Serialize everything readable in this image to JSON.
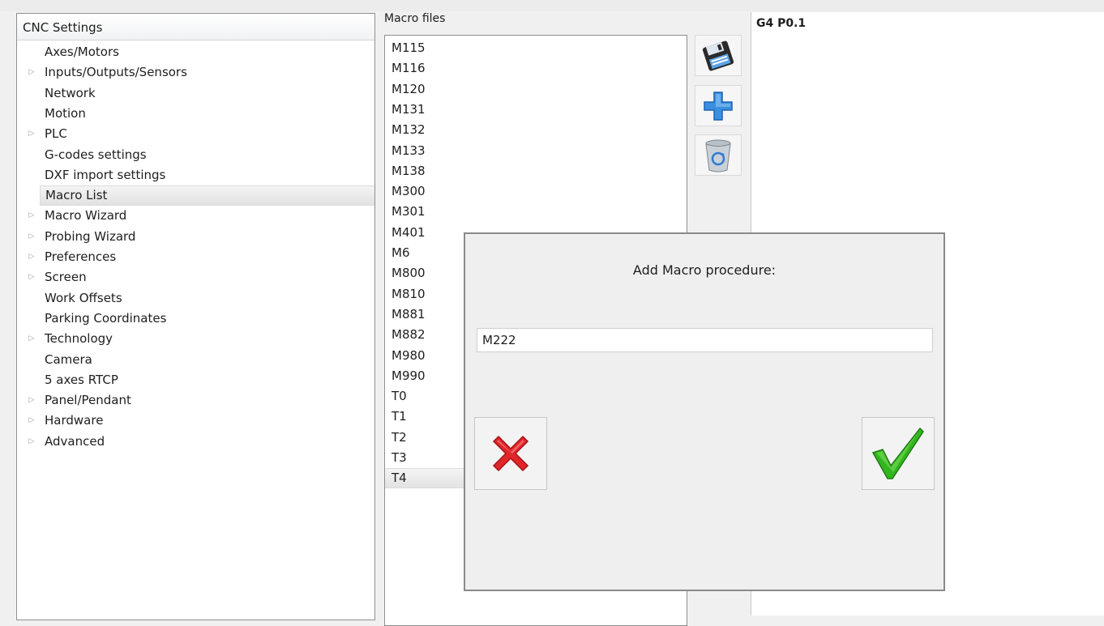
{
  "settings_tree": {
    "header": "CNC Settings",
    "items": [
      {
        "label": "Axes/Motors",
        "expandable": false
      },
      {
        "label": "Inputs/Outputs/Sensors",
        "expandable": true
      },
      {
        "label": "Network",
        "expandable": false
      },
      {
        "label": "Motion",
        "expandable": false
      },
      {
        "label": "PLC",
        "expandable": true
      },
      {
        "label": "G-codes settings",
        "expandable": false
      },
      {
        "label": "DXF import settings",
        "expandable": false
      },
      {
        "label": "Macro List",
        "expandable": false,
        "selected": true
      },
      {
        "label": "Macro Wizard",
        "expandable": true
      },
      {
        "label": "Probing Wizard",
        "expandable": true
      },
      {
        "label": "Preferences",
        "expandable": true
      },
      {
        "label": "Screen",
        "expandable": true
      },
      {
        "label": "Work Offsets",
        "expandable": false
      },
      {
        "label": "Parking Coordinates",
        "expandable": false
      },
      {
        "label": "Technology",
        "expandable": true
      },
      {
        "label": "Camera",
        "expandable": false
      },
      {
        "label": "5 axes RTCP",
        "expandable": false
      },
      {
        "label": "Panel/Pendant",
        "expandable": true
      },
      {
        "label": "Hardware",
        "expandable": true
      },
      {
        "label": "Advanced",
        "expandable": true
      }
    ]
  },
  "macro_files": {
    "caption": "Macro files",
    "selected": "T4",
    "items": [
      "M115",
      "M116",
      "M120",
      "M131",
      "M132",
      "M133",
      "M138",
      "M300",
      "M301",
      "M401",
      "M6",
      "M800",
      "M810",
      "M881",
      "M882",
      "M980",
      "M990",
      "T0",
      "T1",
      "T2",
      "T3",
      "T4"
    ]
  },
  "toolbar": {
    "buttons": [
      {
        "name": "save",
        "icon": "floppy-disk-icon"
      },
      {
        "name": "add",
        "icon": "plus-icon"
      },
      {
        "name": "delete",
        "icon": "recycle-bin-icon"
      }
    ]
  },
  "editor": {
    "content": "G4 P0.1"
  },
  "dialog": {
    "title": "Add Macro procedure:",
    "input_value": "M222",
    "cancel_icon": "red-x-icon",
    "ok_icon": "green-check-icon"
  },
  "colors": {
    "cancel_red": "#e0262a",
    "ok_green": "#33b51f",
    "plus_blue": "#3a8fe0"
  }
}
